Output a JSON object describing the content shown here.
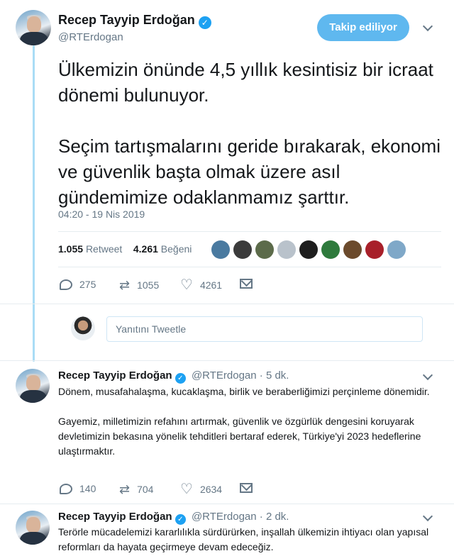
{
  "main_tweet": {
    "author_name": "Recep Tayyip Erdoğan",
    "handle": "@RTErdogan",
    "follow_button": "Takip ediliyor",
    "text_paragraphs": [
      "Ülkemizin önünde 4,5 yıllık kesintisiz bir icraat dönemi bulunuyor.",
      "Seçim tartışmalarını geride bırakarak, ekonomi ve güvenlik başta olmak üzere asıl gündemimize odaklanmamız şarttır."
    ],
    "timestamp": "04:20 - 19 Nis 2019",
    "retweet_count": "1.055",
    "retweet_label": "Retweet",
    "like_count": "4.261",
    "like_label": "Beğeni",
    "liker_colors": [
      "#4a7aa0",
      "#3b3b3b",
      "#5c6b4a",
      "#b9c2cb",
      "#1e1e1e",
      "#2e7a3c",
      "#6b4a2c",
      "#a8202a",
      "#7fa8c8"
    ],
    "actions": {
      "replies": "275",
      "retweets": "1055",
      "likes": "4261"
    }
  },
  "reply_composer": {
    "placeholder": "Yanıtını Tweetle"
  },
  "replies": [
    {
      "author_name": "Recep Tayyip Erdoğan",
      "meta": "@RTErdogan · 5 dk.",
      "paragraphs": [
        "Dönem, musafahalaşma, kucaklaşma, birlik ve beraberliğimizi perçinleme dönemidir.",
        "Gayemiz, milletimizin refahını artırmak, güvenlik ve özgürlük dengesini koruyarak devletimizin bekasına yönelik tehditleri bertaraf ederek, Türkiye'yi 2023 hedeflerine ulaştırmaktır."
      ],
      "actions": {
        "replies": "140",
        "retweets": "704",
        "likes": "2634"
      }
    },
    {
      "author_name": "Recep Tayyip Erdoğan",
      "meta": "@RTErdogan · 2 dk.",
      "paragraphs": [
        "Terörle mücadelemizi kararlılıkla sürdürürken, inşallah ülkemizin ihtiyacı olan yapısal reformları da hayata geçirmeye devam edeceğiz."
      ]
    }
  ],
  "colors": {
    "accent": "#1da1f2",
    "follow_button": "#5fb8ef",
    "muted_text": "#657786",
    "thread_line": "#a9dcf5"
  }
}
